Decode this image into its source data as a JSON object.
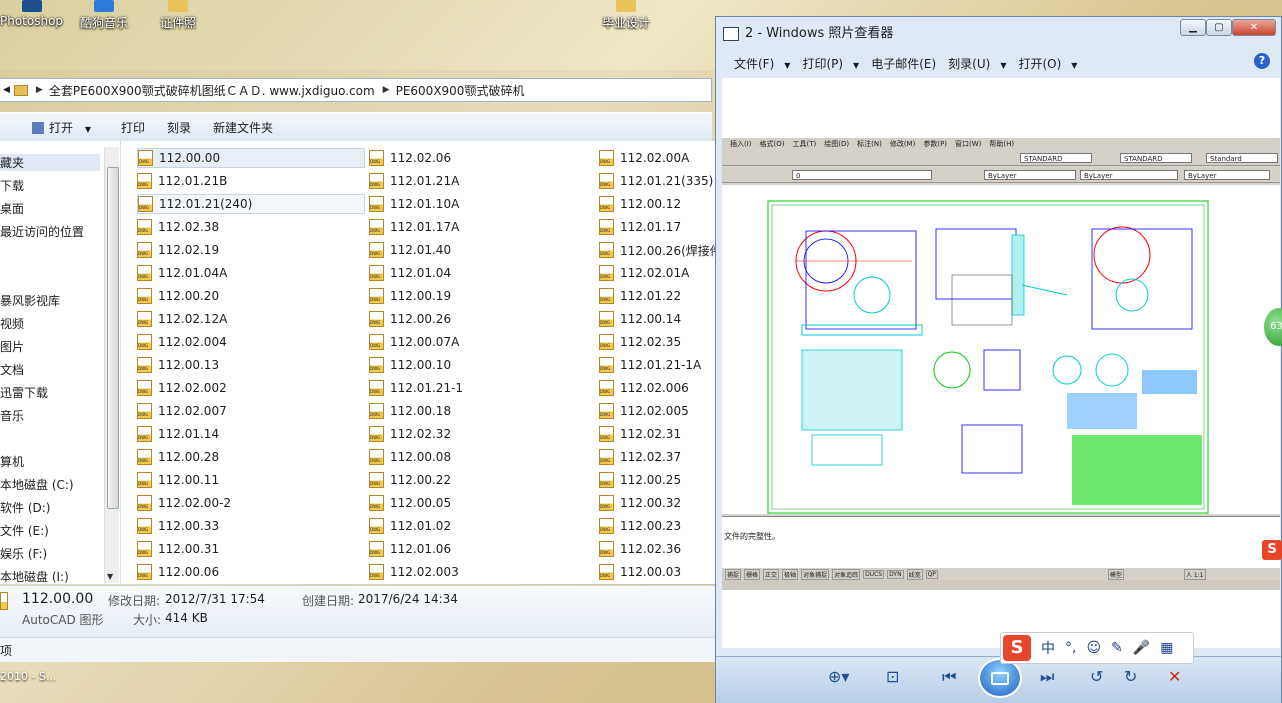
{
  "desktop": {
    "icons": [
      "Photoshop",
      "酷狗音乐",
      "证件照",
      "毕业设计"
    ]
  },
  "explorer": {
    "breadcrumb": [
      "全套PE600X900颚式破碎机图纸ＣＡＤ. www.jxdiguo.com",
      "PE600X900颚式破碎机"
    ],
    "toolbar": {
      "open": "打开",
      "print": "打印",
      "burn": "刻录",
      "new_folder": "新建文件夹"
    },
    "nav": [
      "藏夹",
      "下载",
      "桌面",
      "最近访问的位置",
      "暴风影视库",
      "视频",
      "图片",
      "文档",
      "迅雷下载",
      "音乐",
      "算机",
      "本地磁盘 (C:)",
      "软件 (D:)",
      "文件 (E:)",
      "娱乐 (F:)",
      "本地磁盘 (I:)"
    ],
    "files": {
      "col1": [
        "112.00.00",
        "112.01.21B",
        "112.01.21(240)",
        "112.02.38",
        "112.02.19",
        "112.01.04A",
        "112.00.20",
        "112.02.12A",
        "112.02.004",
        "112.00.13",
        "112.02.002",
        "112.02.007",
        "112.01.14",
        "112.00.28",
        "112.00.11",
        "112.02.00-2",
        "112.00.33",
        "112.00.31",
        "112.00.06"
      ],
      "col2": [
        "112.02.06",
        "112.01.21A",
        "112.01.10A",
        "112.01.17A",
        "112.01.40",
        "112.01.04",
        "112.00.19",
        "112.00.26",
        "112.00.07A",
        "112.00.10",
        "112.01.21-1",
        "112.00.18",
        "112.02.32",
        "112.00.08",
        "112.00.22",
        "112.00.05",
        "112.01.02",
        "112.01.06",
        "112.02.003"
      ],
      "col3": [
        "112.02.00A",
        "112.01.21(335)",
        "112.00.12",
        "112.01.17",
        "112.00.26(焊接件",
        "112.02.01A",
        "112.01.22",
        "112.00.14",
        "112.02.35",
        "112.01.21-1A",
        "112.02.006",
        "112.02.005",
        "112.02.31",
        "112.02.37",
        "112.00.25",
        "112.00.32",
        "112.00.23",
        "112.02.36",
        "112.00.03"
      ]
    },
    "details": {
      "name": "112.00.00",
      "type": "AutoCAD 图形",
      "modified_label": "修改日期:",
      "modified": "2012/7/31 17:54",
      "created_label": "创建日期:",
      "created": "2017/6/24 14:34",
      "size_label": "大小:",
      "size": "414 KB"
    },
    "status": "项"
  },
  "taskbar": {
    "left_item": "2010 - S..."
  },
  "viewer": {
    "title": "2 - Windows 照片查看器",
    "menu": [
      "文件(F)",
      "打印(P)",
      "电子邮件(E)",
      "刻录(U)",
      "打开(O)"
    ],
    "help": "?",
    "cad": {
      "menu": [
        "插入(I)",
        "格式(O)",
        "工具(T)",
        "绘图(D)",
        "标注(N)",
        "修改(M)",
        "参数(P)",
        "窗口(W)",
        "帮助(H)"
      ],
      "style1": "STANDARD",
      "style2": "STANDARD",
      "style3": "Standard",
      "layer": "0",
      "color": "ByLayer",
      "linetype": "ByLayer",
      "lineweight": "ByLayer",
      "cmd_text": "文件的完整性。",
      "status_items": [
        "捕捉",
        "栅格",
        "正交",
        "极轴",
        "对象捕捉",
        "对象追踪",
        "DUCS",
        "DYN",
        "线宽",
        "QP"
      ],
      "model": "模型",
      "scale": "人 1:1"
    }
  },
  "ime": {
    "logo": "S",
    "items": [
      "中",
      "°,",
      "☺",
      "✎",
      "🎤",
      "▦"
    ]
  },
  "badge": "63"
}
